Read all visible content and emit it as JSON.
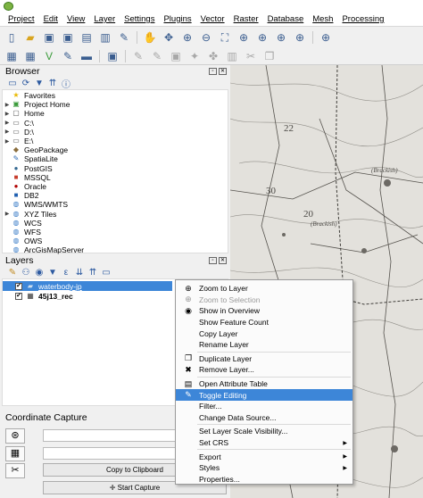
{
  "menubar": {
    "items": [
      "Project",
      "Edit",
      "View",
      "Layer",
      "Settings",
      "Plugins",
      "Vector",
      "Raster",
      "Database",
      "Mesh",
      "Processing"
    ]
  },
  "browser": {
    "title": "Browser",
    "items": [
      {
        "label": "Favorites",
        "icon": "star-icon",
        "glyph": "★",
        "color": "#e8b800",
        "expandable": false
      },
      {
        "label": "Project Home",
        "icon": "project-home-icon",
        "glyph": "▣",
        "color": "#3b9b3b",
        "expandable": true
      },
      {
        "label": "Home",
        "icon": "home-folder-icon",
        "glyph": "▢",
        "color": "#555555",
        "expandable": true
      },
      {
        "label": "C:\\",
        "icon": "drive-icon",
        "glyph": "▭",
        "color": "#555555",
        "expandable": true
      },
      {
        "label": "D:\\",
        "icon": "drive-icon",
        "glyph": "▭",
        "color": "#555555",
        "expandable": true
      },
      {
        "label": "E:\\",
        "icon": "drive-icon",
        "glyph": "▭",
        "color": "#555555",
        "expandable": true
      },
      {
        "label": "GeoPackage",
        "icon": "geopackage-icon",
        "glyph": "◆",
        "color": "#8a6d3b",
        "expandable": false
      },
      {
        "label": "SpatiaLite",
        "icon": "spatialite-icon",
        "glyph": "✎",
        "color": "#2e6bb5",
        "expandable": false
      },
      {
        "label": "PostGIS",
        "icon": "postgis-icon",
        "glyph": "●",
        "color": "#336791",
        "expandable": false
      },
      {
        "label": "MSSQL",
        "icon": "mssql-icon",
        "glyph": "■",
        "color": "#c63b2b",
        "expandable": false
      },
      {
        "label": "Oracle",
        "icon": "oracle-icon",
        "glyph": "●",
        "color": "#b00000",
        "expandable": false
      },
      {
        "label": "DB2",
        "icon": "db2-icon",
        "glyph": "■",
        "color": "#1f5fb0",
        "expandable": false
      },
      {
        "label": "WMS/WMTS",
        "icon": "wms-icon",
        "glyph": "◍",
        "color": "#3a7cc7",
        "expandable": false
      },
      {
        "label": "XYZ Tiles",
        "icon": "xyz-tiles-icon",
        "glyph": "◍",
        "color": "#3a7cc7",
        "expandable": true
      },
      {
        "label": "WCS",
        "icon": "wcs-icon",
        "glyph": "◍",
        "color": "#3a7cc7",
        "expandable": false
      },
      {
        "label": "WFS",
        "icon": "wfs-icon",
        "glyph": "◍",
        "color": "#3a7cc7",
        "expandable": false
      },
      {
        "label": "OWS",
        "icon": "ows-icon",
        "glyph": "◍",
        "color": "#3a7cc7",
        "expandable": false
      },
      {
        "label": "ArcGisMapServer",
        "icon": "arcgis-icon",
        "glyph": "◍",
        "color": "#3a7cc7",
        "expandable": false
      }
    ]
  },
  "layers": {
    "title": "Layers",
    "items": [
      {
        "label": "waterbody-jp",
        "checked": true,
        "selected": true,
        "icon": "polygon-layer-icon",
        "glyph": "▰"
      },
      {
        "label": "45j13_rec",
        "checked": true,
        "selected": false,
        "icon": "raster-layer-icon",
        "glyph": "▦"
      }
    ]
  },
  "coordinate_capture": {
    "title": "Coordinate Capture",
    "copy_label": "Copy to Clipboard",
    "start_label": "Start Capture"
  },
  "context_menu": {
    "items": [
      {
        "label": "Zoom to Layer",
        "icon": "zoom-to-layer-icon",
        "glyph": "⊕",
        "disabled": false,
        "highlighted": false,
        "submenu": false,
        "sep_before": false
      },
      {
        "label": "Zoom to Selection",
        "icon": "zoom-to-selection-icon",
        "glyph": "⊕",
        "disabled": true,
        "highlighted": false,
        "submenu": false,
        "sep_before": false
      },
      {
        "label": "Show in Overview",
        "icon": "overview-icon",
        "glyph": "◉",
        "disabled": false,
        "highlighted": false,
        "submenu": false,
        "sep_before": false
      },
      {
        "label": "Show Feature Count",
        "icon": "",
        "glyph": "",
        "disabled": false,
        "highlighted": false,
        "submenu": false,
        "sep_before": false
      },
      {
        "label": "Copy Layer",
        "icon": "",
        "glyph": "",
        "disabled": false,
        "highlighted": false,
        "submenu": false,
        "sep_before": false
      },
      {
        "label": "Rename Layer",
        "icon": "",
        "glyph": "",
        "disabled": false,
        "highlighted": false,
        "submenu": false,
        "sep_before": false
      },
      {
        "label": "Duplicate Layer",
        "icon": "duplicate-icon",
        "glyph": "❐",
        "disabled": false,
        "highlighted": false,
        "submenu": false,
        "sep_before": true
      },
      {
        "label": "Remove Layer...",
        "icon": "remove-icon",
        "glyph": "✖",
        "disabled": false,
        "highlighted": false,
        "submenu": false,
        "sep_before": false
      },
      {
        "label": "Open Attribute Table",
        "icon": "table-icon",
        "glyph": "▤",
        "disabled": false,
        "highlighted": false,
        "submenu": false,
        "sep_before": true
      },
      {
        "label": "Toggle Editing",
        "icon": "pencil-icon",
        "glyph": "✎",
        "disabled": false,
        "highlighted": true,
        "submenu": false,
        "sep_before": false
      },
      {
        "label": "Filter...",
        "icon": "",
        "glyph": "",
        "disabled": false,
        "highlighted": false,
        "submenu": false,
        "sep_before": false
      },
      {
        "label": "Change Data Source...",
        "icon": "",
        "glyph": "",
        "disabled": false,
        "highlighted": false,
        "submenu": false,
        "sep_before": false
      },
      {
        "label": "Set Layer Scale Visibility...",
        "icon": "",
        "glyph": "",
        "disabled": false,
        "highlighted": false,
        "submenu": false,
        "sep_before": true
      },
      {
        "label": "Set CRS",
        "icon": "",
        "glyph": "",
        "disabled": false,
        "highlighted": false,
        "submenu": true,
        "sep_before": false
      },
      {
        "label": "Export",
        "icon": "",
        "glyph": "",
        "disabled": false,
        "highlighted": false,
        "submenu": true,
        "sep_before": true
      },
      {
        "label": "Styles",
        "icon": "",
        "glyph": "",
        "disabled": false,
        "highlighted": false,
        "submenu": true,
        "sep_before": false
      },
      {
        "label": "Properties...",
        "icon": "",
        "glyph": "",
        "disabled": false,
        "highlighted": false,
        "submenu": false,
        "sep_before": false
      }
    ]
  },
  "map": {
    "labels": [
      "22",
      "30",
      "20",
      "(Brackish)",
      "(Brackish)"
    ]
  },
  "colors": {
    "selection": "#3d86d8",
    "map_paper": "#e3e1dc"
  }
}
